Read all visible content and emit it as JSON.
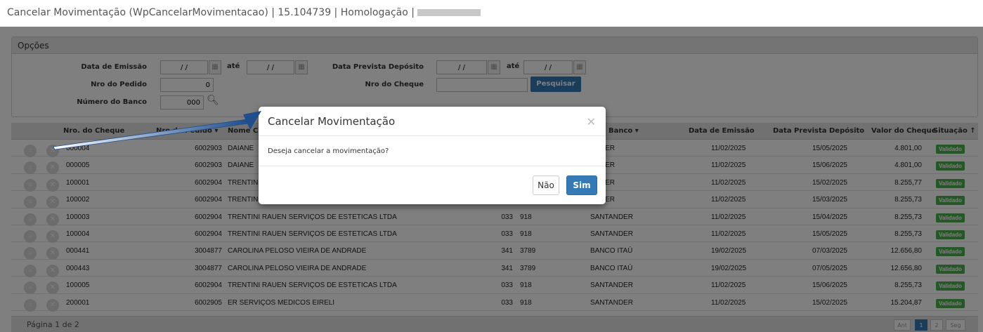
{
  "window": {
    "title": "Cancelar Movimentação (WpCancelarMovimentacao) | 15.104739 | Homologação |"
  },
  "filters": {
    "panel_title": "Opções",
    "data_emissao_label": "Data de Emissão",
    "date_placeholder_value": "/ /",
    "ate_label": "até",
    "data_prevista_label": "Data Prevista Depósito",
    "nro_pedido_label": "Nro do Pedido",
    "nro_pedido_value": "0",
    "nro_cheque_label": "Nro do Cheque",
    "nro_cheque_value": "",
    "numero_banco_label": "Número do Banco",
    "numero_banco_value": "000",
    "search_button": "Pesquisar"
  },
  "grid": {
    "columns": {
      "nro_cheque": "Nro. do Cheque",
      "nro_pedido": "Nro do Pedido",
      "nome_cliente": "Nome Cl",
      "banco": "Banco",
      "data_emissao": "Data de Emissão",
      "data_prevista": "Data Prevista Depósito",
      "valor": "Valor do Cheque",
      "situacao": "Situação"
    },
    "rows": [
      {
        "cheque": "000004",
        "pedido": "6002903",
        "cliente": "DAIANE",
        "agencia": "",
        "conta": "",
        "banco": "ANDER",
        "emissao": "11/02/2025",
        "prevista": "15/05/2025",
        "valor": "4.801,00",
        "situacao": "Validado"
      },
      {
        "cheque": "000005",
        "pedido": "6002903",
        "cliente": "DAIANE",
        "agencia": "",
        "conta": "",
        "banco": "ANDER",
        "emissao": "11/02/2025",
        "prevista": "15/06/2025",
        "valor": "4.801,00",
        "situacao": "Validado"
      },
      {
        "cheque": "100001",
        "pedido": "6002904",
        "cliente": "TRENTIN",
        "agencia": "",
        "conta": "",
        "banco": "ANDER",
        "emissao": "11/02/2025",
        "prevista": "15/02/2025",
        "valor": "8.255,77",
        "situacao": "Validado"
      },
      {
        "cheque": "100002",
        "pedido": "6002904",
        "cliente": "TRENTIN",
        "agencia": "",
        "conta": "",
        "banco": "ANDER",
        "emissao": "11/02/2025",
        "prevista": "15/03/2025",
        "valor": "8.255,73",
        "situacao": "Validado"
      },
      {
        "cheque": "100003",
        "pedido": "6002904",
        "cliente": "TRENTINI RAUEN SERVIÇOS DE ESTETICAS LTDA",
        "agencia": "033",
        "conta": "918",
        "banco": "SANTANDER",
        "emissao": "11/02/2025",
        "prevista": "15/04/2025",
        "valor": "8.255,73",
        "situacao": "Validado"
      },
      {
        "cheque": "100004",
        "pedido": "6002904",
        "cliente": "TRENTINI RAUEN SERVIÇOS DE ESTETICAS LTDA",
        "agencia": "033",
        "conta": "918",
        "banco": "SANTANDER",
        "emissao": "11/02/2025",
        "prevista": "15/05/2025",
        "valor": "8.255,73",
        "situacao": "Validado"
      },
      {
        "cheque": "000441",
        "pedido": "3004877",
        "cliente": "CAROLINA PELOSO VIEIRA DE ANDRADE",
        "agencia": "341",
        "conta": "3789",
        "banco": "BANCO ITAÚ",
        "emissao": "19/02/2025",
        "prevista": "07/03/2025",
        "valor": "12.656,80",
        "situacao": "Validado"
      },
      {
        "cheque": "000443",
        "pedido": "3004877",
        "cliente": "CAROLINA PELOSO VIEIRA DE ANDRADE",
        "agencia": "341",
        "conta": "3789",
        "banco": "BANCO ITAÚ",
        "emissao": "19/02/2025",
        "prevista": "07/05/2025",
        "valor": "12.656,80",
        "situacao": "Validado"
      },
      {
        "cheque": "100005",
        "pedido": "6002904",
        "cliente": "TRENTINI RAUEN SERVIÇOS DE ESTETICAS LTDA",
        "agencia": "033",
        "conta": "918",
        "banco": "SANTANDER",
        "emissao": "11/02/2025",
        "prevista": "15/06/2025",
        "valor": "8.255,73",
        "situacao": "Validado"
      },
      {
        "cheque": "200001",
        "pedido": "6002905",
        "cliente": "ER SERVIÇOS MEDICOS EIRELI",
        "agencia": "033",
        "conta": "918",
        "banco": "SANTANDER",
        "emissao": "11/02/2025",
        "prevista": "15/02/2025",
        "valor": "15.204,87",
        "situacao": "Validado"
      }
    ]
  },
  "pagination": {
    "label": "Página 1 de 2",
    "prev": "Ant",
    "page1": "1",
    "page2": "2",
    "next": "Seg"
  },
  "modal": {
    "title": "Cancelar Movimentação",
    "message": "Deseja cancelar a movimentação?",
    "no_button": "Não",
    "yes_button": "Sim"
  },
  "colors": {
    "primary": "#337ab7",
    "success": "#4cae4c",
    "arrow": "#1f4e8c"
  }
}
